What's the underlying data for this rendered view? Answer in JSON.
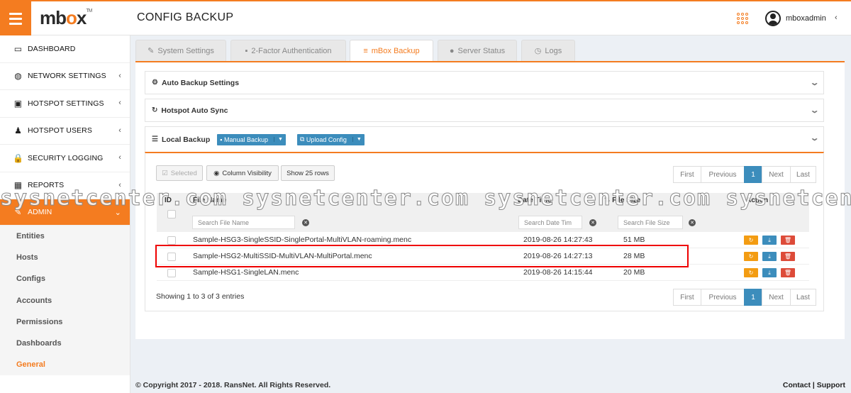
{
  "header": {
    "brand_m": "mb",
    "brand_o": "o",
    "brand_x": "x",
    "brand_tm": "TM",
    "page_title": "CONFIG BACKUP",
    "username": "mboxadmin",
    "user_caret": "‹"
  },
  "sidebar": {
    "items": [
      {
        "label": "DASHBOARD",
        "icon": "monitor-icon",
        "glyph": "▭",
        "caret": ""
      },
      {
        "label": "NETWORK SETTINGS",
        "icon": "globe-icon",
        "glyph": "◍",
        "caret": "‹"
      },
      {
        "label": "HOTSPOT SETTINGS",
        "icon": "hotspot-icon",
        "glyph": "▣",
        "caret": "‹"
      },
      {
        "label": "HOTSPOT USERS",
        "icon": "users-icon",
        "glyph": "♟",
        "caret": "‹"
      },
      {
        "label": "SECURITY LOGGING",
        "icon": "lock-icon",
        "glyph": "🔒",
        "caret": "‹"
      },
      {
        "label": "REPORTS",
        "icon": "calendar-icon",
        "glyph": "▦",
        "caret": "‹"
      },
      {
        "label": "ADMIN",
        "icon": "wrench-icon",
        "glyph": "✎",
        "caret": "⌄"
      }
    ],
    "subitems": [
      "Entities",
      "Hosts",
      "Configs",
      "Accounts",
      "Permissions",
      "Dashboards",
      "General"
    ]
  },
  "tabs": [
    {
      "label": "System Settings",
      "icon": "wrench-icon",
      "glyph": "✎"
    },
    {
      "label": "2-Factor Authentication",
      "icon": "lock-icon",
      "glyph": "▪"
    },
    {
      "label": "mBox Backup",
      "icon": "database-icon",
      "glyph": "≡"
    },
    {
      "label": "Server Status",
      "icon": "info-icon",
      "glyph": "●"
    },
    {
      "label": "Logs",
      "icon": "clock-icon",
      "glyph": "◷"
    }
  ],
  "panels": {
    "auto_backup": "Auto Backup Settings",
    "hotspot_sync": "Hotspot Auto Sync",
    "local_backup": "Local Backup",
    "manual_backup": "Manual Backup",
    "upload_config": "Upload Config",
    "chevron": "⌄"
  },
  "toolbar": {
    "selected": "Selected",
    "column_visibility": "Column Visibility",
    "show_rows": "Show 25 rows"
  },
  "pagination": {
    "first": "First",
    "previous": "Previous",
    "page": "1",
    "next": "Next",
    "last": "Last"
  },
  "table": {
    "headers": {
      "id": "ID",
      "file_name": "File Name",
      "date_time": "Date Time",
      "file_size": "File Size",
      "action": "Action"
    },
    "placeholders": {
      "file_name": "Search File Name",
      "date_time": "Search Date Tim",
      "file_size": "Search File Size"
    },
    "rows": [
      {
        "file_name": "Sample-HSG3-SingleSSID-SinglePortal-MultiVLAN-roaming.menc",
        "date_time": "2019-08-26 14:27:43",
        "size": "51 MB"
      },
      {
        "file_name": "Sample-HSG2-MultiSSID-MultiVLAN-MultiPortal.menc",
        "date_time": "2019-08-26 14:27:13",
        "size": "28 MB"
      },
      {
        "file_name": "Sample-HSG1-SingleLAN.menc",
        "date_time": "2019-08-26 14:15:44",
        "size": "20 MB"
      }
    ],
    "showing": "Showing 1 to 3 of 3 entries"
  },
  "watermark": "sysnetcenter.com sysnetcenter.com sysnetcenter.com sysnetcent",
  "footer": {
    "copyright": "© Copyright 2017 - 2018. RansNet. All Rights Reserved.",
    "contact": "Contact",
    "separator": "|",
    "support": "Support"
  },
  "colors": {
    "accent": "#f47c20",
    "primary": "#3c8dbc",
    "warning": "#f39c12",
    "danger": "#dd4b39"
  }
}
